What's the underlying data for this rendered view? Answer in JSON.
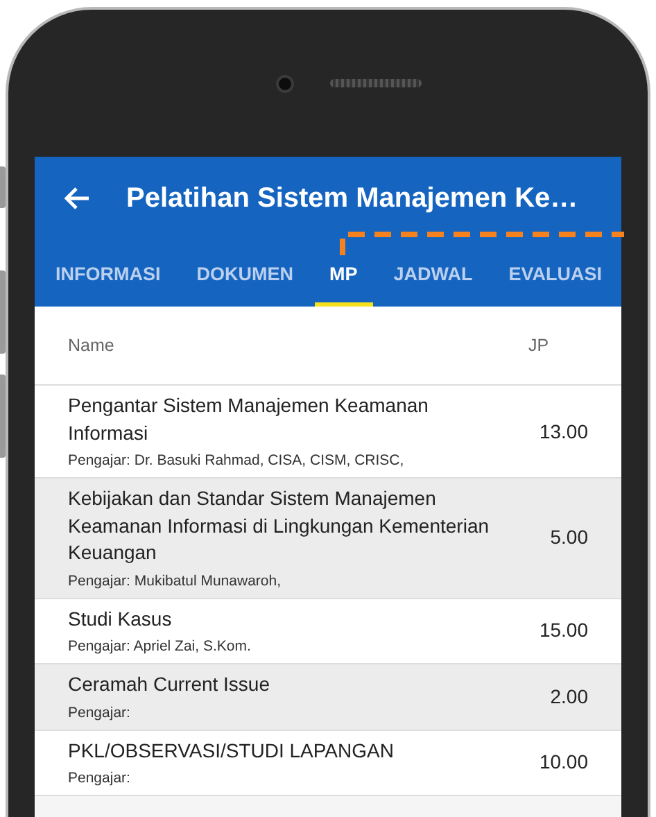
{
  "app_bar": {
    "title": "Pelatihan Sistem Manajemen Ke…"
  },
  "tabs": [
    {
      "label": "INFORMASI",
      "selected": false
    },
    {
      "label": "DOKUMEN",
      "selected": false
    },
    {
      "label": "MP",
      "selected": true
    },
    {
      "label": "JADWAL",
      "selected": false
    },
    {
      "label": "EVALUASI",
      "selected": false
    }
  ],
  "table": {
    "columns": [
      "Name",
      "JP"
    ],
    "rows": [
      {
        "name": "Pengantar Sistem Manajemen Keamanan Informasi",
        "teacher": "Pengajar: Dr. Basuki Rahmad, CISA, CISM, CRISC,",
        "jp": "13.00"
      },
      {
        "name": "Kebijakan dan Standar Sistem Manajemen Keamanan Informasi di Lingkungan Kementerian Keuangan",
        "teacher": "Pengajar: Mukibatul Munawaroh,",
        "jp": "5.00"
      },
      {
        "name": "Studi Kasus",
        "teacher": "Pengajar: Apriel Zai, S.Kom.",
        "jp": "15.00"
      },
      {
        "name": "Ceramah Current Issue",
        "teacher": "Pengajar:",
        "jp": "2.00"
      },
      {
        "name": "PKL/OBSERVASI/STUDI LAPANGAN",
        "teacher": "Pengajar:",
        "jp": "10.00"
      }
    ]
  }
}
